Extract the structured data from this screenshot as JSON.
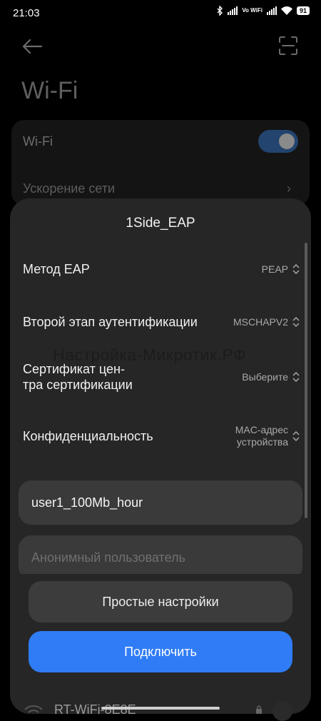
{
  "status_bar": {
    "time": "21:03",
    "vowifi": "Vo WiFi",
    "battery": "91",
    "icons": [
      "bluetooth-icon",
      "signal-icon",
      "vowifi-icon",
      "signal-icon",
      "wifi-icon",
      "battery-icon"
    ]
  },
  "page": {
    "title": "Wi-Fi",
    "wifi_label": "Wi-Fi",
    "wifi_enabled": true,
    "acceleration_label": "Ускорение сети"
  },
  "dialog": {
    "title": "1Side_EAP",
    "rows": [
      {
        "label": "Метод EAP",
        "value": "PEAP"
      },
      {
        "label": "Второй этап аутентификации",
        "value": "MSCHAPV2"
      },
      {
        "label_line1": "Сертификат цен-",
        "label_line2": "тра сертификации",
        "value": "Выберите"
      },
      {
        "label": "Конфиденциальность",
        "value_line1": "MAC-адрес",
        "value_line2": "устройства"
      }
    ],
    "identity_value": "user1_100Mb_hour",
    "anonymous_placeholder": "Анонимный пользователь",
    "simple_settings_button": "Простые настройки",
    "connect_button": "Подключить"
  },
  "watermark": "Настройка-Микротик.РФ",
  "peek_network": "RT-WiFi-8E8E",
  "colors": {
    "accent": "#2f7cf6",
    "dialog_bg": "#262626",
    "field_bg": "#3a3a3a"
  }
}
